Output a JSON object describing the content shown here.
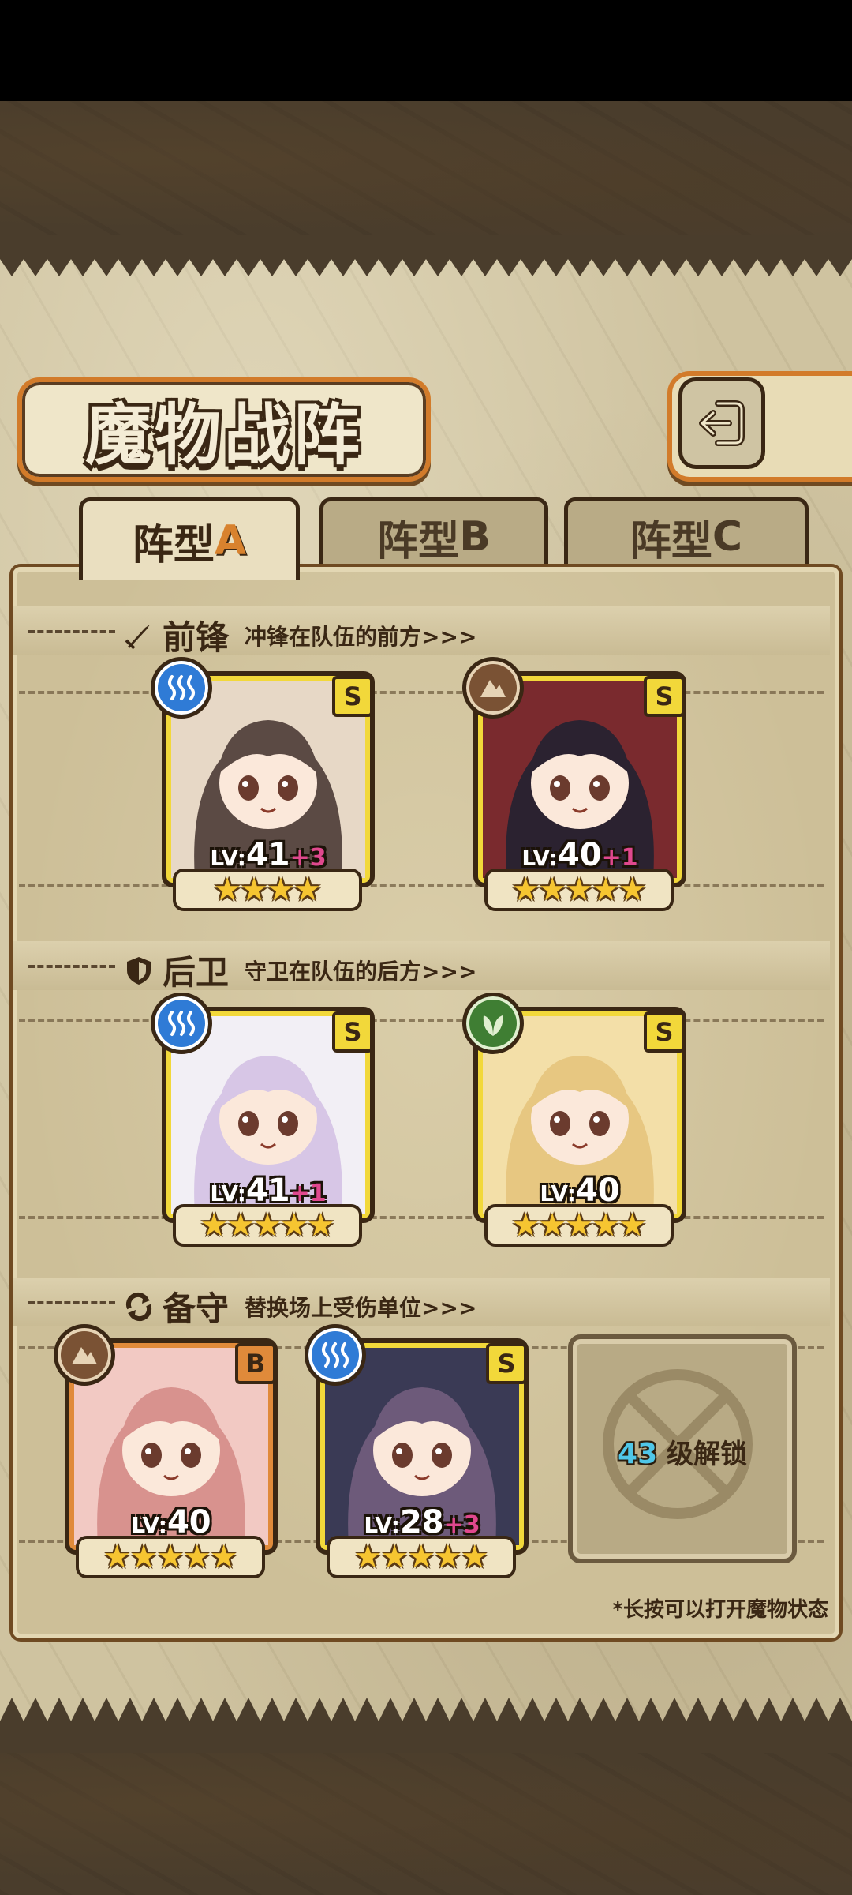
{
  "header": {
    "title": "魔物战阵",
    "back_icon": "return-arrow-icon"
  },
  "tabs": [
    {
      "label": "阵型",
      "letter": "A",
      "active": true
    },
    {
      "label": "阵型",
      "letter": "B",
      "active": false
    },
    {
      "label": "阵型",
      "letter": "C",
      "active": false
    }
  ],
  "sections": {
    "front": {
      "name": "前锋",
      "desc": "冲锋在队伍的前方>>>",
      "icon": "sword-icon"
    },
    "rear": {
      "name": "后卫",
      "desc": "守卫在队伍的后方>>>",
      "icon": "shield-icon"
    },
    "reserve": {
      "name": "备守",
      "desc": "替换场上受伤单位>>>",
      "icon": "swap-icon"
    }
  },
  "units": {
    "front1": {
      "rank": "S",
      "element": "water",
      "lv_label": "LV:",
      "level": "41",
      "plus": "+3",
      "stars": 4
    },
    "front2": {
      "rank": "S",
      "element": "earth",
      "lv_label": "LV:",
      "level": "40",
      "plus": "+1",
      "stars": 5
    },
    "rear1": {
      "rank": "S",
      "element": "water",
      "lv_label": "LV:",
      "level": "41",
      "plus": "+1",
      "stars": 5
    },
    "rear2": {
      "rank": "S",
      "element": "wood",
      "lv_label": "LV:",
      "level": "40",
      "plus": "",
      "stars": 5
    },
    "reserve1": {
      "rank": "B",
      "element": "earth",
      "lv_label": "LV:",
      "level": "40",
      "plus": "",
      "stars": 5
    },
    "reserve2": {
      "rank": "S",
      "element": "water",
      "lv_label": "LV:",
      "level": "28",
      "plus": "+3",
      "stars": 5
    }
  },
  "locked_slot": {
    "level": "43",
    "text": "级解锁"
  },
  "footnote": "*长按可以打开魔物状态",
  "colors": {
    "accent": "#d27b2a",
    "s_rank": "#f2d83a",
    "b_rank": "#e08a3a",
    "plus": "#e0488e"
  }
}
